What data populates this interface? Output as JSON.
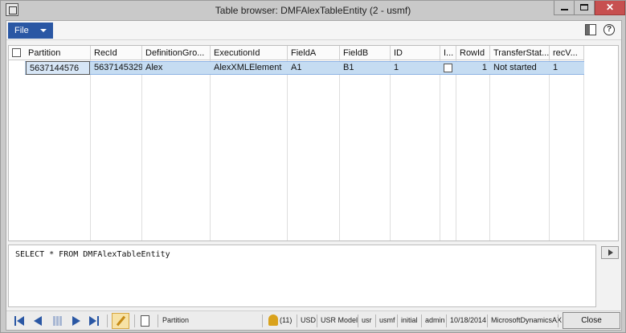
{
  "window": {
    "title": "Table browser: DMFAlexTableEntity (2 - usmf)",
    "close_symbol": "✕"
  },
  "ribbon": {
    "file_label": "File",
    "help_symbol": "?"
  },
  "grid": {
    "columns": [
      "Partition",
      "RecId",
      "DefinitionGro...",
      "ExecutionId",
      "FieldA",
      "FieldB",
      "ID",
      "I...",
      "RowId",
      "TransferStat...",
      "recV..."
    ],
    "rows": [
      {
        "partition": "5637144576",
        "recid": "5637145329",
        "definition_group": "Alex",
        "execution_id": "AlexXMLElement",
        "field_a": "A1",
        "field_b": "B1",
        "id": "1",
        "i_checked": false,
        "row_id": "1",
        "transfer_status": "Not started",
        "rec_version": "1"
      }
    ]
  },
  "query": {
    "text": "SELECT * FROM DMFAlexTableEntity"
  },
  "statusbar": {
    "field": "Partition",
    "notifications": "(11)",
    "currency": "USD",
    "model": "USR Model",
    "layer": "usr",
    "company": "usmf",
    "partition": "initial",
    "user": "admin",
    "date": "10/18/2014",
    "server": "MicrosoftDynamicsAX",
    "close_label": "Close"
  },
  "colors": {
    "accent": "#2a57a4",
    "selected_row": "#c5dcf2",
    "close_button": "#c75050"
  }
}
